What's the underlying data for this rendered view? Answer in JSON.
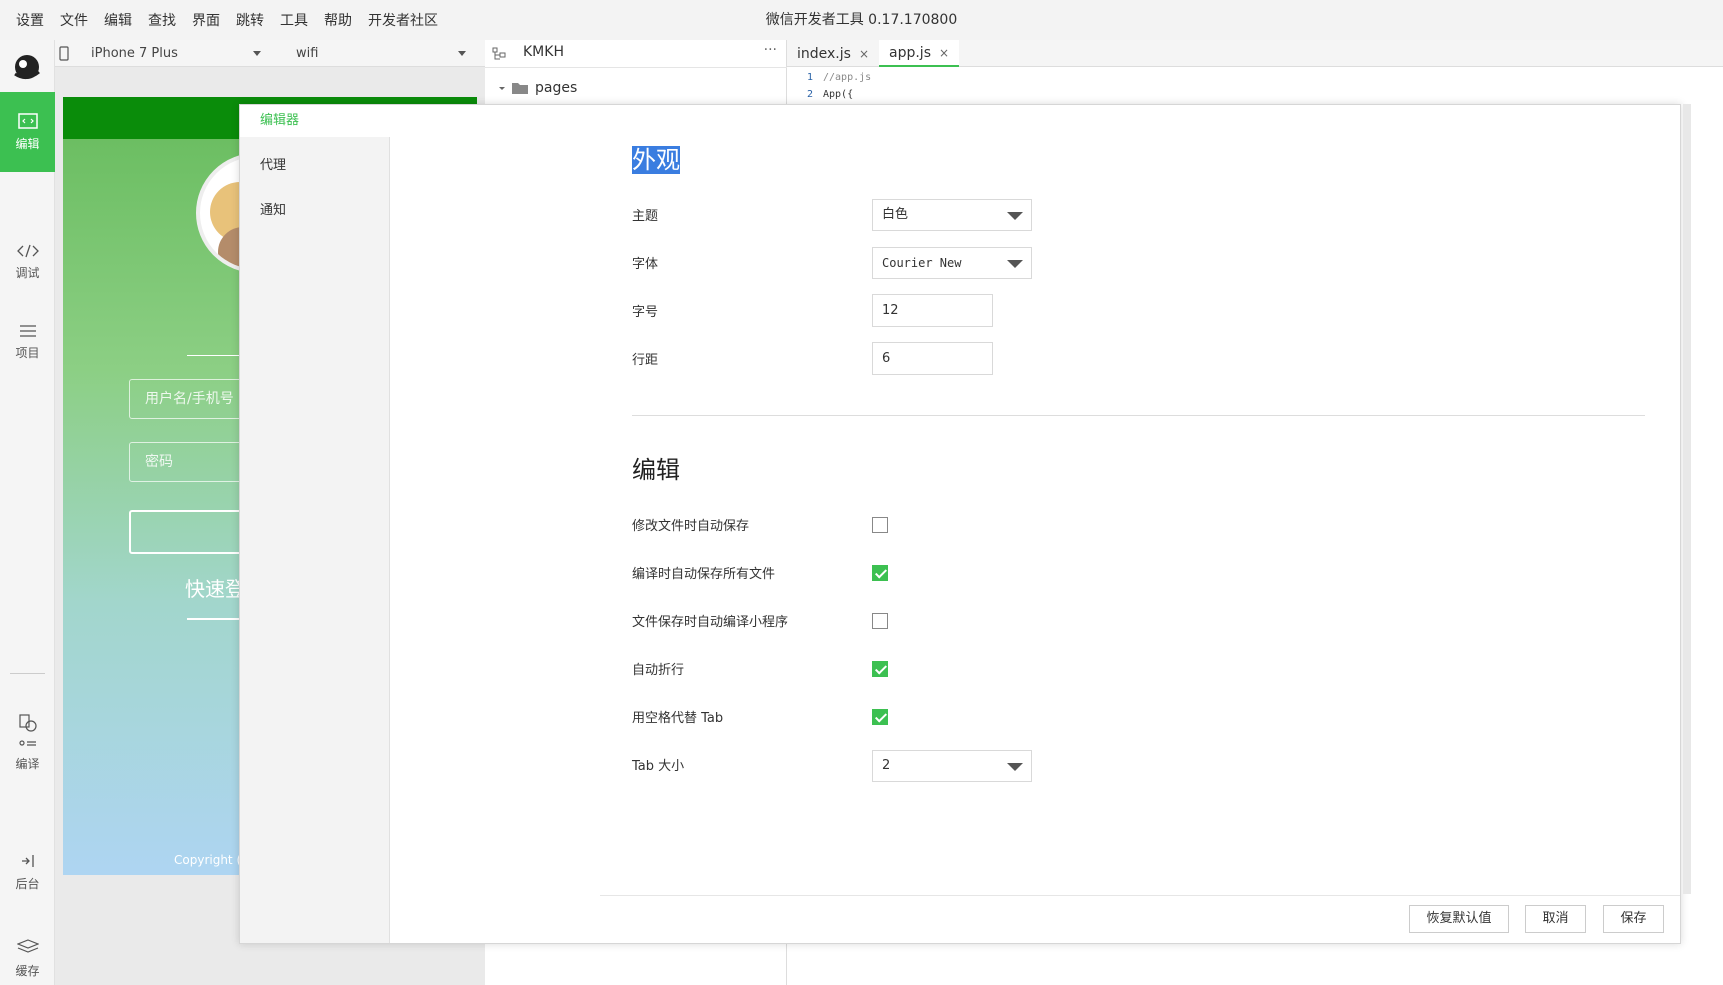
{
  "menubar": {
    "items": [
      "设置",
      "文件",
      "编辑",
      "查找",
      "界面",
      "跳转",
      "工具",
      "帮助",
      "开发者社区"
    ],
    "title": "微信开发者工具 0.17.170800"
  },
  "sidebar": {
    "edit_label": "编辑",
    "debug_label": "调试",
    "project_label": "项目",
    "compile_label": "编译",
    "backend_label": "后台",
    "cache_label": "缓存"
  },
  "toolbar": {
    "device": "iPhone 7 Plus",
    "network": "wifi"
  },
  "phone": {
    "username_placeholder": "用户名/手机号",
    "password_placeholder": "密码",
    "quick_label": "快速登",
    "copyright": "Copyright ("
  },
  "filetree": {
    "project_name": "KMKH",
    "more": "···",
    "folder": "pages"
  },
  "editor": {
    "tabs": [
      {
        "label": "index.js",
        "close": "×"
      },
      {
        "label": "app.js",
        "close": "×"
      }
    ],
    "lines": [
      {
        "num": "1",
        "text": "//app.js"
      },
      {
        "num": "2",
        "text": "App({"
      }
    ]
  },
  "dialog": {
    "nav": [
      "编辑器",
      "代理",
      "通知"
    ],
    "appearance": {
      "title": "外观",
      "theme_label": "主题",
      "theme_value": "白色",
      "font_label": "字体",
      "font_value": "Courier New",
      "size_label": "字号",
      "size_value": "12",
      "spacing_label": "行距",
      "spacing_value": "6"
    },
    "edit": {
      "title": "编辑",
      "options": [
        {
          "label": "修改文件时自动保存",
          "checked": false
        },
        {
          "label": "编译时自动保存所有文件",
          "checked": true
        },
        {
          "label": "文件保存时自动编译小程序",
          "checked": false
        },
        {
          "label": "自动折行",
          "checked": true
        },
        {
          "label": "用空格代替 Tab",
          "checked": true
        }
      ],
      "tab_size_label": "Tab 大小",
      "tab_size_value": "2"
    },
    "buttons": {
      "restore": "恢复默认值",
      "cancel": "取消",
      "save": "保存"
    }
  },
  "colors": {
    "accent": "#3cc051",
    "selection": "#3a7de0",
    "nav_bar": "#0a8c0a"
  }
}
